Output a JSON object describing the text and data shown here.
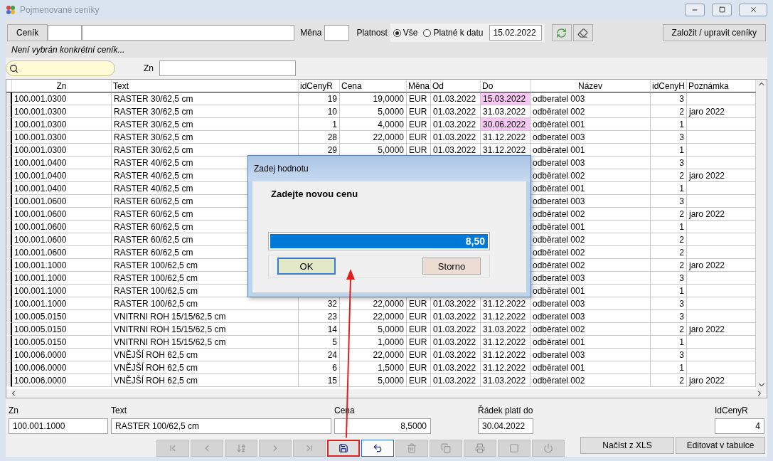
{
  "window": {
    "title": "Pojmenované ceníky"
  },
  "filter": {
    "cenik_button": "Ceník",
    "mena_label": "Měna",
    "platnost_label": "Platnost",
    "radios": [
      {
        "label": "Vše",
        "selected": true
      },
      {
        "label": "Platné k datu",
        "selected": false
      }
    ],
    "date": "15.02.2022",
    "manage_button": "Založit / upravit ceníky",
    "status": "Není vybrán konkrétní ceník..."
  },
  "search": {
    "zn_label": "Zn"
  },
  "table": {
    "columns": [
      "Zn",
      "Text",
      "idCenyR",
      "Cena",
      "Měna",
      "Od",
      "Do",
      "Název",
      "idCenyH",
      "Poznámka"
    ],
    "rows": [
      {
        "zn": "100.001.0300",
        "text": "RASTER  30/62,5 cm",
        "idcenyr": "19",
        "cena": "19,0000",
        "mena": "EUR",
        "od": "01.03.2022",
        "do": "15.03.2022",
        "do_highlight": true,
        "nazev": "odberatel 003",
        "idcenyh": "3"
      },
      {
        "zn": "100.001.0300",
        "text": "RASTER  30/62,5 cm",
        "idcenyr": "10",
        "cena": "5,0000",
        "mena": "EUR",
        "od": "01.03.2022",
        "do": "31.03.2022",
        "do_highlight": false,
        "nazev": "odběratel 002",
        "idcenyh": "2",
        "poznamka": "jaro 2022"
      },
      {
        "zn": "100.001.0300",
        "text": "RASTER  30/62,5 cm",
        "idcenyr": "1",
        "cena": "4,0000",
        "mena": "EUR",
        "od": "01.03.2022",
        "do": "30.06.2022",
        "do_highlight": true,
        "nazev": "odběratel 001",
        "idcenyh": "1"
      },
      {
        "zn": "100.001.0300",
        "text": "RASTER  30/62,5 cm",
        "idcenyr": "28",
        "cena": "22,0000",
        "mena": "EUR",
        "od": "01.03.2022",
        "do": "31.12.2022",
        "do_highlight": false,
        "nazev": "odberatel 003",
        "idcenyh": "3"
      },
      {
        "zn": "100.001.0300",
        "text": "RASTER  30/62,5 cm",
        "idcenyr": "29",
        "cena": "5,0000",
        "mena": "EUR",
        "od": "01.03.2022",
        "do": "31.12.2022",
        "do_highlight": false,
        "nazev": "odběratel 001",
        "idcenyh": "1"
      },
      {
        "zn": "100.001.0400",
        "text": "RASTER  40/62,5 cm",
        "nazev": "odberatel 003",
        "idcenyh": "3"
      },
      {
        "zn": "100.001.0400",
        "text": "RASTER  40/62,5 cm",
        "nazev": "odběratel 002",
        "idcenyh": "2",
        "poznamka": "jaro 2022"
      },
      {
        "zn": "100.001.0400",
        "text": "RASTER  40/62,5 cm",
        "nazev": "odběratel 001",
        "idcenyh": "1"
      },
      {
        "zn": "100.001.0600",
        "text": "RASTER  60/62,5 cm",
        "nazev": "odberatel 003",
        "idcenyh": "3"
      },
      {
        "zn": "100.001.0600",
        "text": "RASTER  60/62,5 cm",
        "nazev": "odběratel 002",
        "idcenyh": "2",
        "poznamka": "jaro 2022"
      },
      {
        "zn": "100.001.0600",
        "text": "RASTER  60/62,5 cm",
        "nazev": "odběratel 001",
        "idcenyh": "1"
      },
      {
        "zn": "100.001.0600",
        "text": "RASTER  60/62,5 cm",
        "nazev": "odběratel 002",
        "idcenyh": "2"
      },
      {
        "zn": "100.001.0600",
        "text": "RASTER  60/62,5 cm",
        "nazev": "odběratel 002",
        "idcenyh": "2"
      },
      {
        "zn": "100.001.1000",
        "text": "RASTER 100/62,5 cm",
        "nazev": "odběratel 002",
        "idcenyh": "2",
        "poznamka": "jaro 2022"
      },
      {
        "zn": "100.001.1000",
        "text": "RASTER 100/62,5 cm",
        "nazev": "odberatel 003",
        "idcenyh": "3"
      },
      {
        "zn": "100.001.1000",
        "text": "RASTER 100/62,5 cm",
        "nazev": "odběratel 001",
        "idcenyh": "1"
      },
      {
        "zn": "100.001.1000",
        "text": "RASTER 100/62,5 cm",
        "idcenyr": "32",
        "cena": "22,0000",
        "mena": "EUR",
        "od": "01.03.2022",
        "do": "31.12.2022",
        "do_highlight": false,
        "nazev": "odberatel 003",
        "idcenyh": "3"
      },
      {
        "zn": "100.005.0150",
        "text": "VNITRNI ROH 15/15/62,5 cm",
        "idcenyr": "23",
        "cena": "22,0000",
        "mena": "EUR",
        "od": "01.03.2022",
        "do": "31.12.2022",
        "do_highlight": false,
        "nazev": "odberatel 003",
        "idcenyh": "3"
      },
      {
        "zn": "100.005.0150",
        "text": "VNITRNI ROH 15/15/62,5 cm",
        "idcenyr": "14",
        "cena": "5,0000",
        "mena": "EUR",
        "od": "01.03.2022",
        "do": "31.03.2022",
        "do_highlight": false,
        "nazev": "odběratel 002",
        "idcenyh": "2",
        "poznamka": "jaro 2022"
      },
      {
        "zn": "100.005.0150",
        "text": "VNITRNI ROH 15/15/62,5 cm",
        "idcenyr": "5",
        "cena": "1,0000",
        "mena": "EUR",
        "od": "01.03.2022",
        "do": "31.12.2022",
        "do_highlight": false,
        "nazev": "odběratel 001",
        "idcenyh": "1"
      },
      {
        "zn": "100.006.0000",
        "text": "VNĚJŠÍ ROH 62,5 cm",
        "idcenyr": "24",
        "cena": "22,0000",
        "mena": "EUR",
        "od": "01.03.2022",
        "do": "31.12.2022",
        "do_highlight": false,
        "nazev": "odberatel 003",
        "idcenyh": "3"
      },
      {
        "zn": "100.006.0000",
        "text": "VNĚJŠÍ ROH 62,5 cm",
        "idcenyr": "6",
        "cena": "1,5000",
        "mena": "EUR",
        "od": "01.03.2022",
        "do": "31.12.2022",
        "do_highlight": false,
        "nazev": "odběratel 001",
        "idcenyh": "1"
      },
      {
        "zn": "100.006.0000",
        "text": "VNĚJŠÍ ROH 62,5 cm",
        "idcenyr": "15",
        "cena": "5,0000",
        "mena": "EUR",
        "od": "01.03.2022",
        "do": "31.03.2022",
        "do_highlight": false,
        "nazev": "odběratel 002",
        "idcenyh": "2",
        "poznamka": "jaro 2022"
      }
    ]
  },
  "detail": {
    "fields": [
      {
        "label": "Zn",
        "value": "100.001.1000",
        "kind": "text"
      },
      {
        "label": "Text",
        "value": "RASTER 100/62,5 cm",
        "kind": "text"
      },
      {
        "label": "Cena",
        "value": "8,5000",
        "kind": "number"
      },
      {
        "label": "Řádek platí do",
        "value": "30.04.2022",
        "kind": "text"
      },
      {
        "label": "IdCenyR",
        "value": "4",
        "kind": "number"
      }
    ]
  },
  "toolbar": [
    {
      "kind": "first",
      "disabled": true,
      "highlighted": false,
      "focused": false
    },
    {
      "kind": "prev",
      "disabled": true,
      "highlighted": false,
      "focused": false
    },
    {
      "kind": "sort",
      "disabled": true,
      "highlighted": false,
      "focused": false
    },
    {
      "kind": "next",
      "disabled": true,
      "highlighted": false,
      "focused": false
    },
    {
      "kind": "last",
      "disabled": true,
      "highlighted": false,
      "focused": false
    },
    {
      "kind": "save",
      "disabled": false,
      "highlighted": true,
      "focused": false
    },
    {
      "kind": "undo",
      "disabled": false,
      "highlighted": false,
      "focused": true
    },
    {
      "kind": "delete",
      "disabled": true,
      "highlighted": false,
      "focused": false
    },
    {
      "kind": "copy",
      "disabled": true,
      "highlighted": false,
      "focused": false
    },
    {
      "kind": "print",
      "disabled": true,
      "highlighted": false,
      "focused": false
    },
    {
      "kind": "stop",
      "disabled": true,
      "highlighted": false,
      "focused": false
    },
    {
      "kind": "power",
      "disabled": true,
      "highlighted": false,
      "focused": false
    }
  ],
  "action_buttons": [
    "Načíst z XLS",
    "Editovat v tabulce"
  ],
  "dialog": {
    "title": "Zadej hodnotu",
    "prompt": "Zadejte novou cenu",
    "value": "8,50",
    "ok": "OK",
    "cancel": "Storno"
  }
}
